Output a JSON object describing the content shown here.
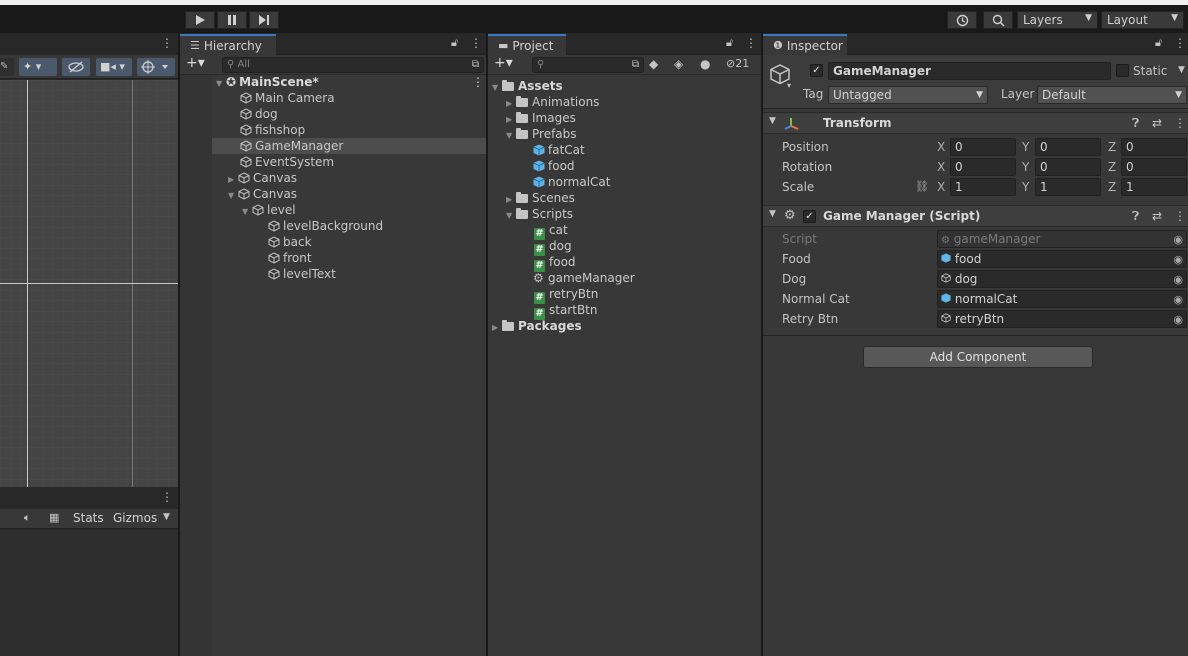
{
  "toolbar": {
    "play_icon": "play-icon",
    "pause_icon": "pause-icon",
    "step_icon": "step-icon",
    "layers_label": "Layers",
    "layout_label": "Layout"
  },
  "scene": {
    "stats_label": "Stats",
    "gizmos_label": "Gizmos"
  },
  "hierarchy": {
    "tab_label": "Hierarchy",
    "search_placeholder": "All",
    "scene_name": "MainScene*",
    "items": [
      {
        "label": "Main Camera"
      },
      {
        "label": "dog"
      },
      {
        "label": "fishshop"
      },
      {
        "label": "GameManager"
      },
      {
        "label": "EventSystem"
      },
      {
        "label": "Canvas"
      },
      {
        "label": "Canvas"
      },
      {
        "label": "level"
      },
      {
        "label": "levelBackground"
      },
      {
        "label": "back"
      },
      {
        "label": "front"
      },
      {
        "label": "levelText"
      }
    ]
  },
  "project": {
    "tab_label": "Project",
    "hidden_count": "21",
    "items": [
      {
        "label": "Assets"
      },
      {
        "label": "Animations"
      },
      {
        "label": "Images"
      },
      {
        "label": "Prefabs"
      },
      {
        "label": "fatCat"
      },
      {
        "label": "food"
      },
      {
        "label": "normalCat"
      },
      {
        "label": "Scenes"
      },
      {
        "label": "Scripts"
      },
      {
        "label": "cat"
      },
      {
        "label": "dog"
      },
      {
        "label": "food"
      },
      {
        "label": "gameManager"
      },
      {
        "label": "retryBtn"
      },
      {
        "label": "startBtn"
      },
      {
        "label": "Packages"
      }
    ]
  },
  "inspector": {
    "tab_label": "Inspector",
    "object_name": "GameManager",
    "static_label": "Static",
    "tag_label": "Tag",
    "tag_value": "Untagged",
    "layer_label": "Layer",
    "layer_value": "Default",
    "transform": {
      "title": "Transform",
      "position_label": "Position",
      "rotation_label": "Rotation",
      "scale_label": "Scale",
      "x": "X",
      "y": "Y",
      "z": "Z",
      "position": [
        "0",
        "0",
        "0"
      ],
      "rotation": [
        "0",
        "0",
        "0"
      ],
      "scale": [
        "1",
        "1",
        "1"
      ]
    },
    "script_component": {
      "title": "Game Manager (Script)",
      "script_label": "Script",
      "script_value": "gameManager",
      "food_label": "Food",
      "food_value": "food",
      "dog_label": "Dog",
      "dog_value": "dog",
      "normal_cat_label": "Normal Cat",
      "normal_cat_value": "normalCat",
      "retry_btn_label": "Retry Btn",
      "retry_btn_value": "retryBtn"
    },
    "add_component_label": "Add Component"
  },
  "colors": {
    "accent": "#3a79bb",
    "script_green": "#3a8e46",
    "prefab_blue": "#5fb4e8"
  }
}
